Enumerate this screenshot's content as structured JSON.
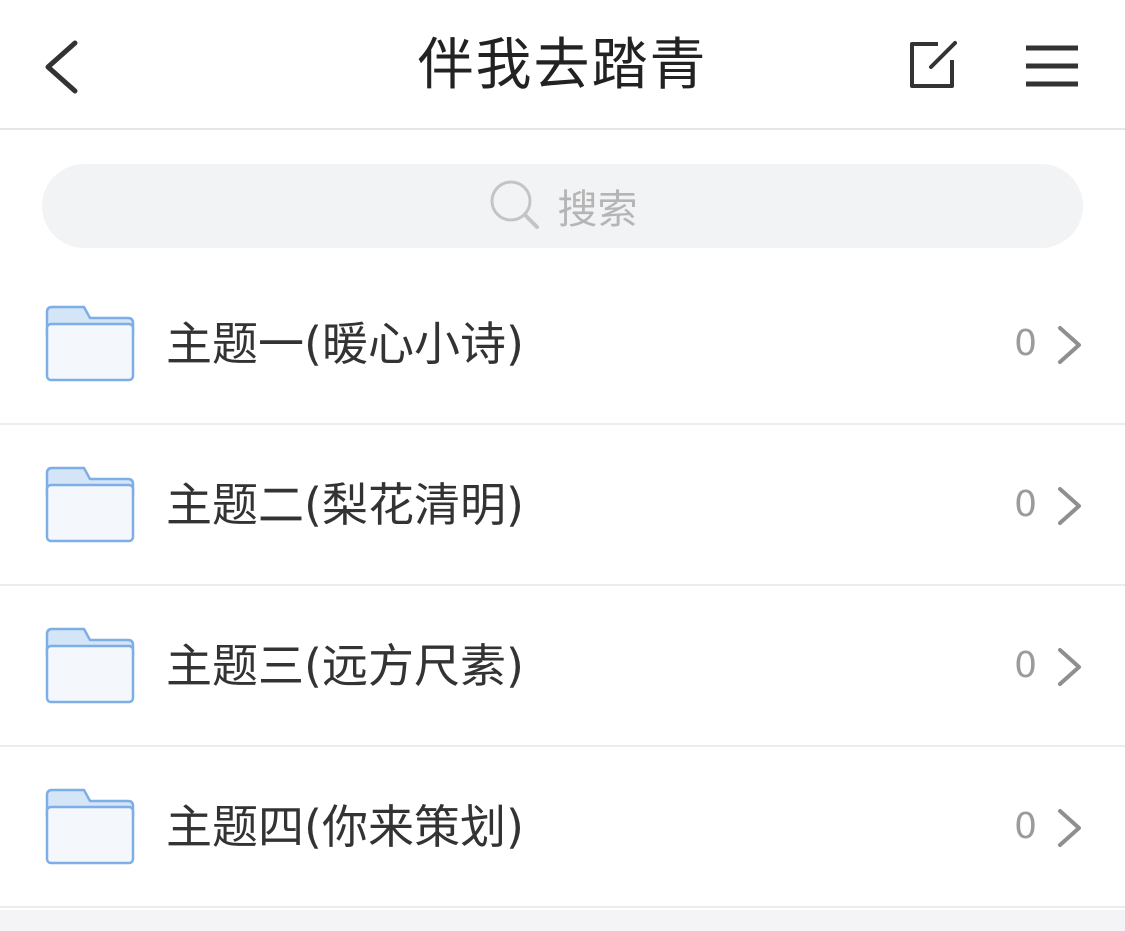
{
  "header": {
    "title": "伴我去踏青",
    "back_icon": "chevron-left-icon",
    "edit_icon": "edit-icon",
    "menu_icon": "hamburger-menu-icon"
  },
  "search": {
    "placeholder": "搜索",
    "icon": "search-icon"
  },
  "folders": [
    {
      "label": "主题一(暖心小诗)",
      "count": "0"
    },
    {
      "label": "主题二(梨花清明)",
      "count": "0"
    },
    {
      "label": "主题三(远方尺素)",
      "count": "0"
    },
    {
      "label": "主题四(你来策划)",
      "count": "0"
    }
  ],
  "colors": {
    "folder_stroke": "#7eaee6",
    "folder_fill": "#f4f7fc",
    "folder_tab": "#d4e5f8",
    "text": "#333333",
    "muted": "#9b9b9b"
  }
}
